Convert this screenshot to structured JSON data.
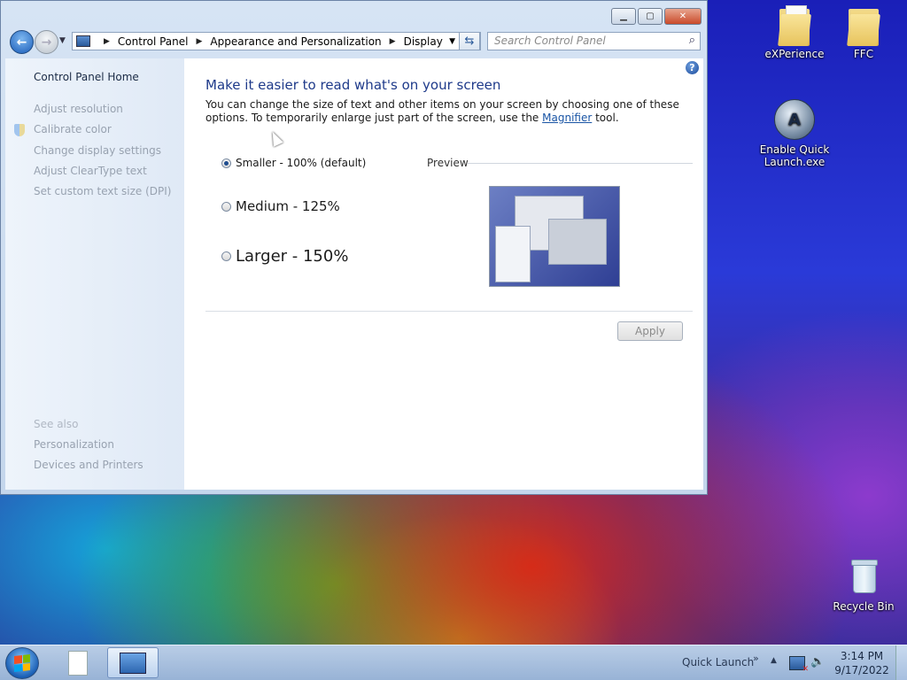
{
  "desktop": {
    "icons": [
      {
        "label": "eXPerience"
      },
      {
        "label": "FFC"
      },
      {
        "label": "Enable Quick Launch.exe"
      },
      {
        "label": "Recycle Bin"
      }
    ]
  },
  "window": {
    "caption_buttons": {
      "minimize": "▁",
      "maximize": "▢",
      "close": "✕"
    },
    "address": {
      "crumbs": [
        "Control Panel",
        "Appearance and Personalization",
        "Display"
      ]
    },
    "search": {
      "placeholder": "Search Control Panel"
    },
    "sidebar": {
      "home": "Control Panel Home",
      "items": [
        "Adjust resolution",
        "Calibrate color",
        "Change display settings",
        "Adjust ClearType text",
        "Set custom text size (DPI)"
      ],
      "see_also_heading": "See also",
      "see_also": [
        "Personalization",
        "Devices and Printers"
      ]
    },
    "main": {
      "title": "Make it easier to read what's on your screen",
      "description_before": "You can change the size of text and other items on your screen by choosing one of these options. To temporarily enlarge just part of the screen, use the ",
      "description_link": "Magnifier",
      "description_after": " tool.",
      "options": [
        {
          "label": "Smaller - 100% (default)",
          "selected": true
        },
        {
          "label": "Medium - 125%",
          "selected": false
        },
        {
          "label": "Larger - 150%",
          "selected": false
        }
      ],
      "preview_label": "Preview",
      "apply_label": "Apply"
    }
  },
  "taskbar": {
    "quick_launch": "Quick Launch",
    "clock_time": "3:14 PM",
    "clock_date": "9/17/2022"
  }
}
